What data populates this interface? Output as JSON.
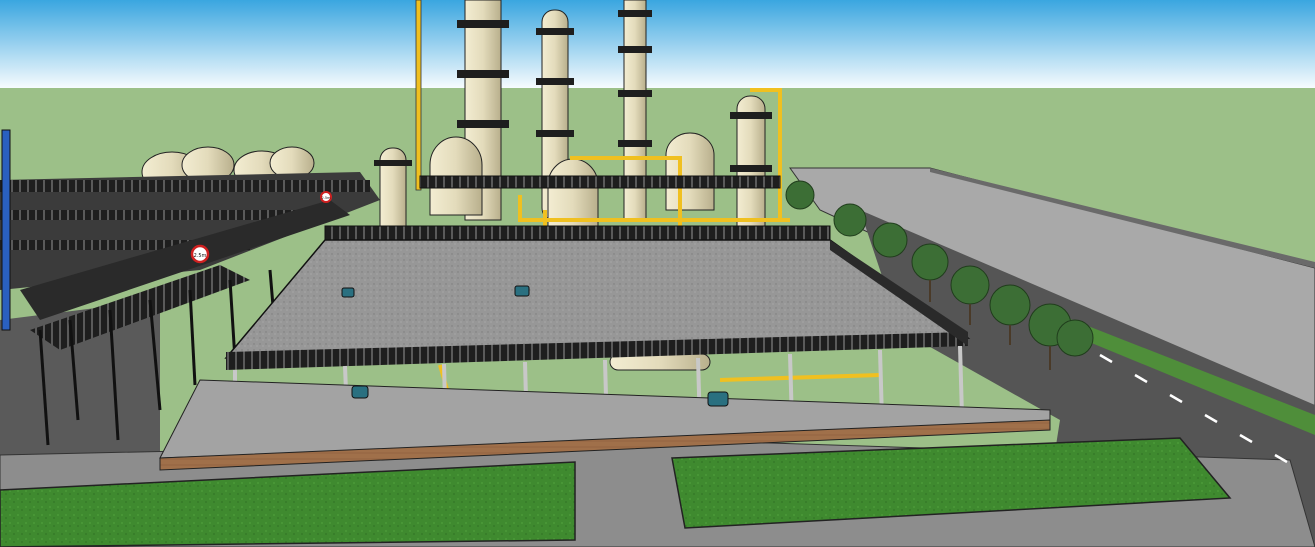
{
  "scene": {
    "subject": "3d-refinery-model",
    "colors": {
      "sky_top": "#3aa6e0",
      "sky_bottom": "#ffffff",
      "ground": "#9cc088",
      "road": "#686868",
      "platform": "#9a9a9a",
      "steel": "#222222",
      "vessel": "#e3dbbb",
      "pipe": "#f0c020",
      "lawn": "#3f8a2f",
      "tree": "#3c6e35",
      "brick": "#a0704a"
    },
    "signs": [
      {
        "label": "2.5m"
      },
      {
        "label": "2.5m"
      }
    ]
  }
}
